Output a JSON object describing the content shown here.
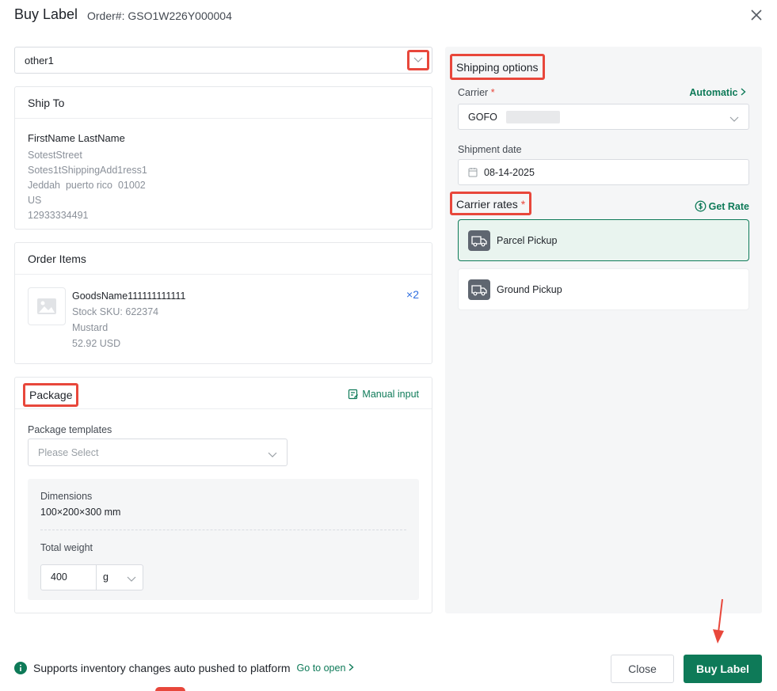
{
  "header": {
    "title": "Buy Label",
    "order": "Order#: GSO1W226Y000004",
    "close_icon": "close-icon"
  },
  "store": {
    "value": "other1"
  },
  "ship_to": {
    "title": "Ship To",
    "name": "FirstName LastName",
    "street": "SotestStreet",
    "address2": "Sotes1tShippingAdd1ress1",
    "city_line": "Jeddah  puerto rico  01002",
    "country": "US",
    "phone": "12933334491"
  },
  "order_items": {
    "title": "Order Items",
    "goods_name": "GoodsName111111111111",
    "sku": "Stock SKU: 622374",
    "variant": "Mustard",
    "price": "52.92 USD",
    "qty": "×2"
  },
  "package": {
    "title": "Package",
    "manual_input": "Manual input",
    "templates_label": "Package templates",
    "templates_placeholder": "Please Select",
    "dimensions_label": "Dimensions",
    "dimensions_value": "100×200×300 mm",
    "weight_label": "Total weight",
    "weight_value": "400",
    "weight_unit": "g"
  },
  "shipping": {
    "title": "Shipping options",
    "carrier_label": "Carrier",
    "required": "*",
    "automatic": "Automatic",
    "carrier_value": "GOFO",
    "date_label": "Shipment date",
    "date_value": "08-14-2025",
    "rates_title": "Carrier rates",
    "get_rate": "Get Rate",
    "rates": [
      {
        "name": "Parcel Pickup",
        "selected": true
      },
      {
        "name": "Ground Pickup",
        "selected": false
      }
    ]
  },
  "footer": {
    "info_text": "Supports inventory changes auto pushed to platform",
    "go_open": "Go to open",
    "close_btn": "Close",
    "buy_btn": "Buy Label"
  },
  "colors": {
    "accent": "#0e7a58",
    "highlight": "#e8473b",
    "qty": "#2f6fe0"
  }
}
